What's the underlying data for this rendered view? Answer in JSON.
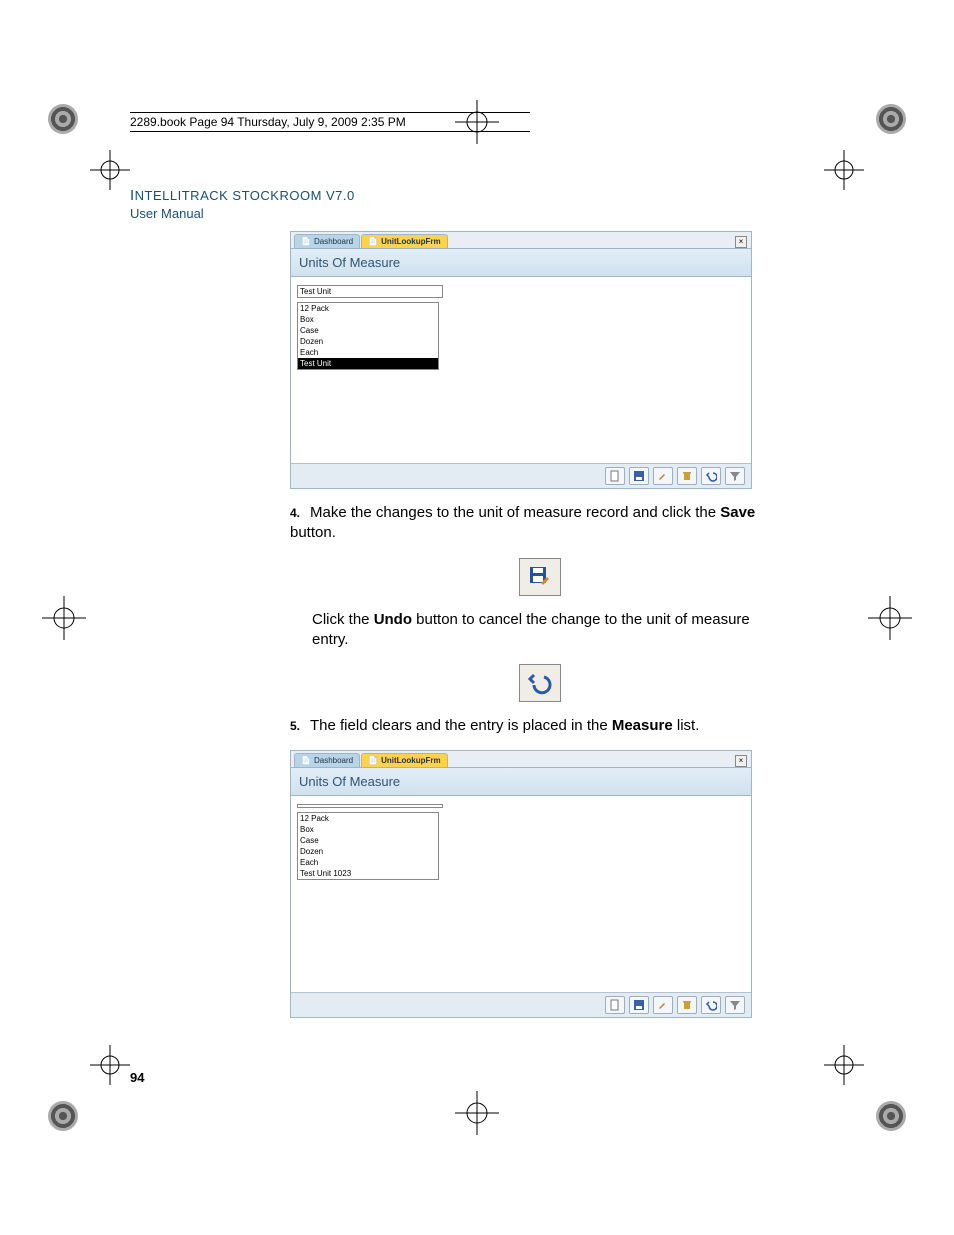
{
  "meta": {
    "line": "2289.book  Page 94  Thursday, July 9, 2009  2:35 PM"
  },
  "header": {
    "title_small": "I",
    "title_rest": "NTELLITRACK STOCKROOM V7.0",
    "subtitle": "User Manual"
  },
  "window1": {
    "tab1": "Dashboard",
    "tab2": "UnitLookupFrm",
    "title": "Units Of Measure",
    "input_value": "Test Unit",
    "items": [
      "12 Pack",
      "Box",
      "Case",
      "Dozen",
      "Each",
      "Test Unit"
    ]
  },
  "step4": {
    "num": "4.",
    "text_a": "Make the changes to the unit of measure record and click the ",
    "bold_a": "Save",
    "text_b": " button.",
    "text_c": "Click the ",
    "bold_c": "Undo",
    "text_d": " button to cancel the change to the unit of measure entry."
  },
  "step5": {
    "num": "5.",
    "text_a": "The field clears and the entry is placed in the ",
    "bold_a": "Measure",
    "text_b": " list."
  },
  "window2": {
    "tab1": "Dashboard",
    "tab2": "UnitLookupFrm",
    "title": "Units Of Measure",
    "input_value": "",
    "items": [
      "12 Pack",
      "Box",
      "Case",
      "Dozen",
      "Each",
      "Test Unit 1023"
    ]
  },
  "footer": {
    "page": "94"
  }
}
